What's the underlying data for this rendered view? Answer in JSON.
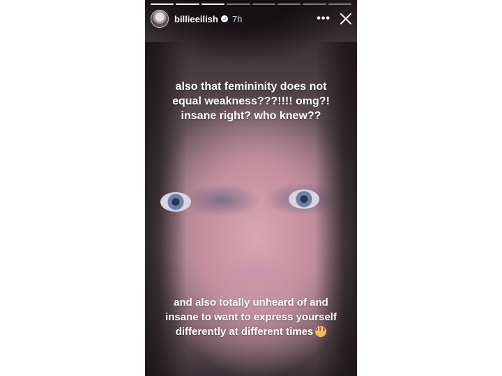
{
  "story": {
    "progress_segments": 8,
    "progress_done": 3,
    "header": {
      "username": "billieeilish",
      "time": "7h",
      "verified_icon": "verified-badge-icon",
      "more_icon": "more-dots-icon",
      "more_label": "•••",
      "close_icon": "close-icon"
    },
    "caption_top": {
      "lines": [
        "also that femininity does not",
        "equal weakness???!!!! omg?!",
        "insane right? who knew??"
      ]
    },
    "caption_bottom": {
      "lines": [
        "and also totally unheard of and",
        "insane to want to express yourself",
        "differently at different times"
      ],
      "emoji": "exploding-head-emoji"
    }
  }
}
